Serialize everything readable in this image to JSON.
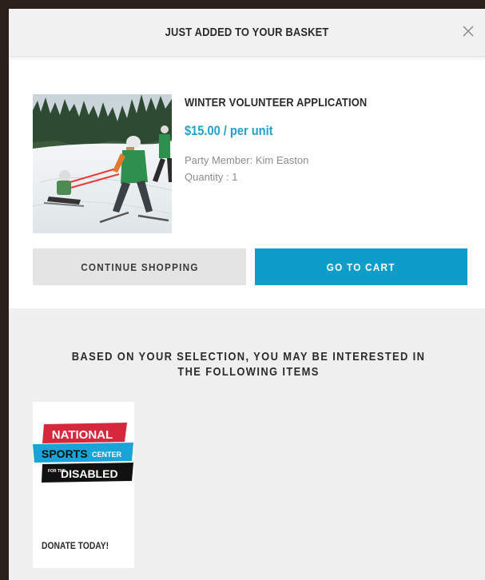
{
  "modal": {
    "title": "JUST ADDED TO YOUR BASKET",
    "close_icon": "close-icon"
  },
  "product": {
    "name": "WINTER VOLUNTEER APPLICATION",
    "price": "$15.00 / per unit",
    "party_member": "Party Member: Kim Easton",
    "quantity": "Quantity : 1",
    "image_icon": "adaptive-skiing-photo"
  },
  "actions": {
    "continue_label": "CONTINUE SHOPPING",
    "cart_label": "GO TO CART"
  },
  "suggestions": {
    "heading": "BASED ON YOUR SELECTION, YOU MAY BE INTERESTED IN THE FOLLOWING ITEMS",
    "items": [
      {
        "label": "DONATE TODAY!",
        "logo_icon": "national-sports-center-logo",
        "logo_text": {
          "line1": "NATIONAL",
          "line2": "SPORTS",
          "line2b": "CENTER",
          "line3a": "FOR THE",
          "line3": "DISABLED"
        }
      }
    ]
  },
  "colors": {
    "accent": "#0e9cc9",
    "price": "#1ea2c8",
    "logo_red": "#d6283c",
    "logo_blue": "#1aa3d6",
    "logo_black": "#111111"
  }
}
